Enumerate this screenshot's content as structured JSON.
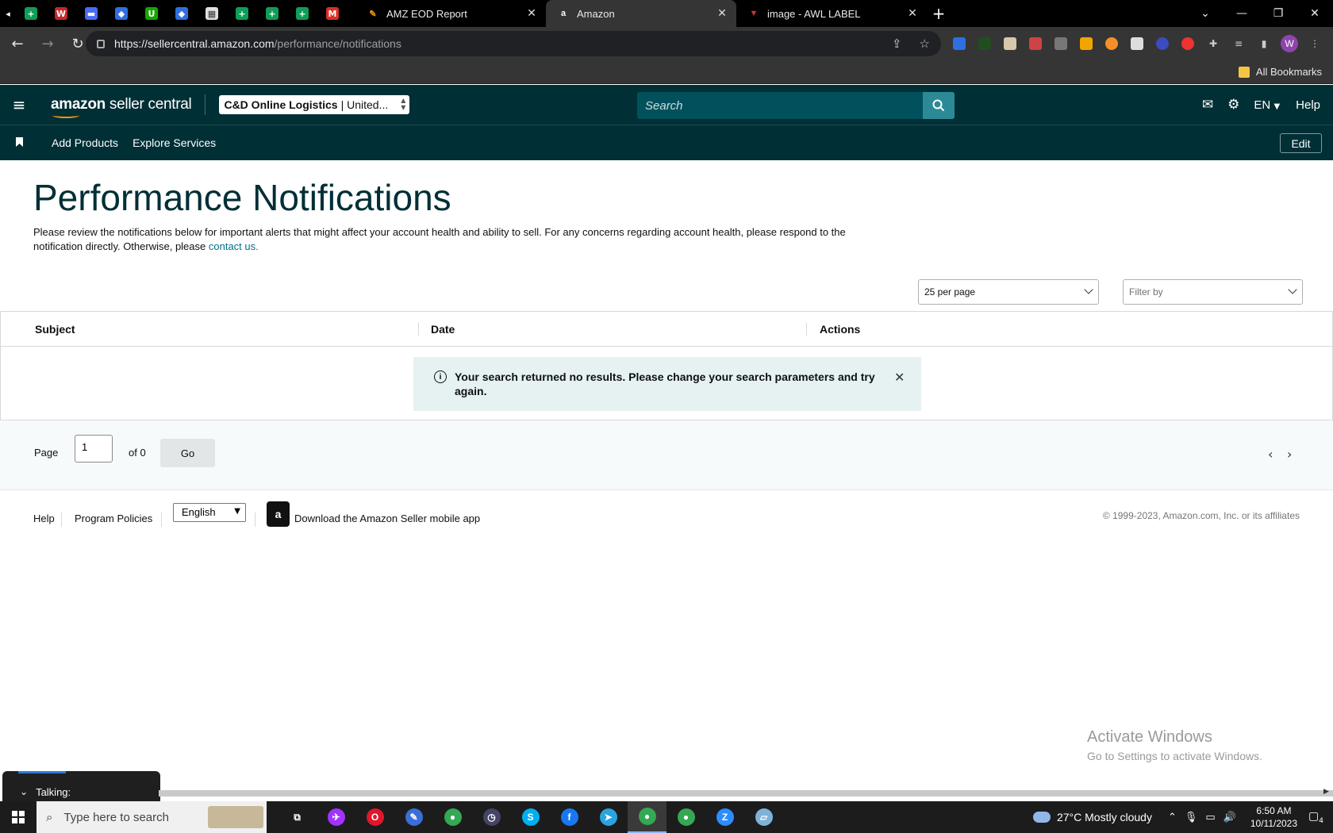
{
  "browser": {
    "pinned_tabs": [
      {
        "icon": "google-sheets-icon",
        "color": "#0f9d58",
        "glyph": "+"
      },
      {
        "icon": "wps-icon",
        "color": "#c62828",
        "glyph": "W"
      },
      {
        "icon": "app-icon",
        "color": "#4a6cf7",
        "glyph": "▬"
      },
      {
        "icon": "dropbox-icon",
        "color": "#2f6fe0",
        "glyph": "◆"
      },
      {
        "icon": "upwork-icon",
        "color": "#14a800",
        "glyph": "U"
      },
      {
        "icon": "dropbox-icon",
        "color": "#2f6fe0",
        "glyph": "◆"
      },
      {
        "icon": "sheet-icon",
        "color": "#e0e0e0",
        "glyph": "▦"
      },
      {
        "icon": "google-sheets-icon",
        "color": "#0f9d58",
        "glyph": "+"
      },
      {
        "icon": "google-sheets-icon",
        "color": "#0f9d58",
        "glyph": "+"
      },
      {
        "icon": "google-sheets-icon",
        "color": "#0f9d58",
        "glyph": "+"
      },
      {
        "icon": "gmail-icon",
        "color": "#d93025",
        "glyph": "M"
      }
    ],
    "tabs": [
      {
        "title": "AMZ EOD Report",
        "icon": "sheets-logo-icon",
        "color": "#f29900",
        "glyph": "✎",
        "active": false
      },
      {
        "title": "Amazon",
        "icon": "amazon-icon",
        "color": "#ffffff",
        "glyph": "a",
        "active": true
      },
      {
        "title": "image - AWL LABEL",
        "icon": "awl-icon",
        "color": "#d32f2f",
        "glyph": "▼",
        "active": false
      }
    ],
    "url_host": "https://sellercentral.amazon.com",
    "url_path": "/performance/notifications",
    "bookmarks_label": "All Bookmarks",
    "profile_initial": "W"
  },
  "header": {
    "logo_brand": "amazon",
    "logo_text": " seller central",
    "account_bold": "C&D Online Logistics",
    "account_rest": "| United...",
    "search_placeholder": "Search",
    "language": "EN",
    "help": "Help"
  },
  "nav": {
    "links": [
      "Add Products",
      "Explore Services"
    ],
    "edit": "Edit"
  },
  "page": {
    "title": "Performance Notifications",
    "desc_text": "Please review the notifications below for important alerts that might affect your account health and ability to sell. For any concerns regarding account health, please respond to the notification directly. Otherwise, please ",
    "desc_link": "contact us.",
    "per_page": "25 per page",
    "filter_by": "Filter by"
  },
  "table": {
    "columns": [
      "Subject",
      "Date",
      "Actions"
    ],
    "rows": [],
    "alert_message": "Your search returned no results. Please change your search parameters and try again."
  },
  "pager": {
    "page_label": "Page",
    "page_value": "1",
    "of_label": "of 0",
    "go_label": "Go"
  },
  "footer": {
    "help": "Help",
    "program_policies": "Program Policies",
    "language": "English",
    "app_link": "Download the Amazon Seller mobile app",
    "copyright": "© 1999-2023, Amazon.com, Inc. or its affiliates"
  },
  "windows": {
    "activate_title": "Activate Windows",
    "activate_sub": "Go to Settings to activate Windows.",
    "talking": "Talking:",
    "search_placeholder": "Type here to search",
    "weather": "27°C  Mostly cloudy",
    "time": "6:50 AM",
    "date": "10/11/2023",
    "notif_count": "4",
    "taskbar_apps": [
      {
        "icon": "task-view-icon",
        "color": "#1c1c1c",
        "glyph": "⧉"
      },
      {
        "icon": "messenger-icon",
        "color": "#a033ff",
        "glyph": "✈"
      },
      {
        "icon": "opera-icon",
        "color": "#e0162b",
        "glyph": "O"
      },
      {
        "icon": "paint-icon",
        "color": "#3a6fd8",
        "glyph": "✎"
      },
      {
        "icon": "chrome-icon",
        "color": "#34a853",
        "glyph": "●"
      },
      {
        "icon": "clock-app-icon",
        "color": "#444466",
        "glyph": "◷"
      },
      {
        "icon": "skype-icon",
        "color": "#00aff0",
        "glyph": "S"
      },
      {
        "icon": "facebook-icon",
        "color": "#1877f2",
        "glyph": "f"
      },
      {
        "icon": "telegram-icon",
        "color": "#2aa3e0",
        "glyph": "➤"
      },
      {
        "icon": "chrome-profile-w-icon",
        "color": "#34a853",
        "glyph": "●"
      },
      {
        "icon": "chrome-profile-va-icon",
        "color": "#34a853",
        "glyph": "●"
      },
      {
        "icon": "zoom-icon",
        "color": "#2d8cff",
        "glyph": "Z"
      },
      {
        "icon": "notes-icon",
        "color": "#7fb2d8",
        "glyph": "▱"
      }
    ]
  },
  "colors": {
    "header_bg": "#002f36",
    "title": "#002f36",
    "link": "#00728a",
    "alert_bg": "#e6f1f2"
  }
}
